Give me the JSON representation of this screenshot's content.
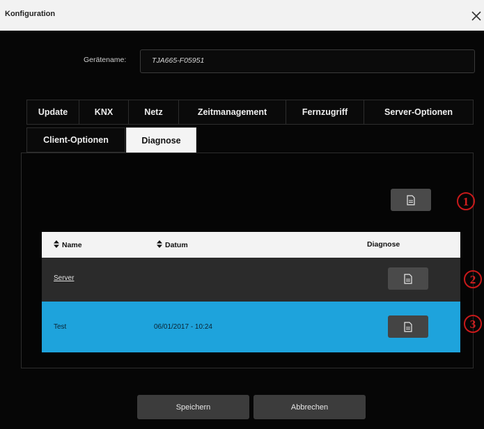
{
  "window": {
    "title": "Konfiguration",
    "close_icon": "close-icon"
  },
  "device": {
    "label": "Gerätename:",
    "value": "TJA665-F05951"
  },
  "tabs": [
    {
      "label": "Update",
      "active": false
    },
    {
      "label": "KNX",
      "active": false
    },
    {
      "label": "Netz",
      "active": false
    },
    {
      "label": "Zeitmanagement",
      "active": false
    },
    {
      "label": "Fernzugriff",
      "active": false
    },
    {
      "label": "Server-Optionen",
      "active": false
    },
    {
      "label": "Client-Optionen",
      "active": false
    },
    {
      "label": "Diagnose",
      "active": true
    }
  ],
  "diagnose": {
    "export_icon": "document-icon",
    "table": {
      "columns": [
        {
          "label": "Name",
          "sortable": true
        },
        {
          "label": "Datum",
          "sortable": true
        },
        {
          "label": "Diagnose",
          "sortable": false
        }
      ],
      "rows": [
        {
          "name": "Server",
          "datum": "",
          "selected": false
        },
        {
          "name": "Test",
          "datum": "06/01/2017 - 10:24",
          "selected": true
        }
      ]
    },
    "markers": [
      "1",
      "2",
      "3"
    ]
  },
  "footer": {
    "save_label": "Speichern",
    "cancel_label": "Abbrechen"
  },
  "colors": {
    "selected_row": "#1ea3dc",
    "marker": "#c8191a",
    "active_tab": "#f4f4f4"
  }
}
